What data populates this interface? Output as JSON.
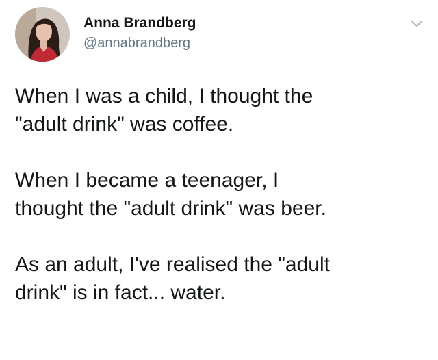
{
  "tweet": {
    "author": {
      "name": "Anna Brandberg",
      "handle": "@annabrandberg"
    },
    "paragraphs": [
      "When I was a child, I thought the\n\"adult drink\" was coffee.",
      "When I became a teenager, I\nthought the \"adult drink\" was beer.",
      "As an adult, I've realised the \"adult\ndrink\" is in fact... water."
    ]
  },
  "icons": {
    "more_menu": "chevron-down-icon",
    "avatar": "profile-photo"
  },
  "colors": {
    "text": "#14171a",
    "secondary_text": "#657786",
    "caret": "#aab8c2",
    "background": "#ffffff"
  }
}
